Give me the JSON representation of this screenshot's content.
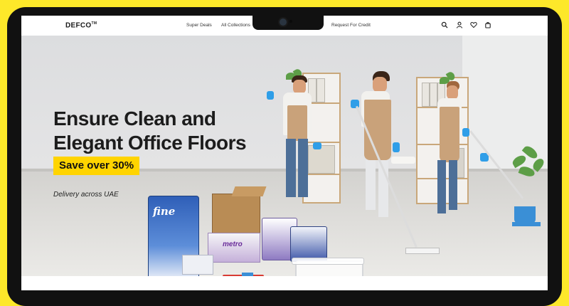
{
  "brand": {
    "logo": "DEFCO",
    "trademark": "TM"
  },
  "nav": {
    "items": [
      "Super Deals",
      "All Collections",
      "Request For Credit"
    ],
    "hidden_item_arrow": "▾",
    "icons": [
      "search-icon",
      "user-icon",
      "heart-icon",
      "cart-icon"
    ]
  },
  "hero": {
    "title": "Ensure Clean and Elegant Office Floors",
    "badge": "Save over 30%",
    "subtitle": "Delivery across UAE"
  },
  "products": {
    "tissue_brand": "fine",
    "detergent_brand": "metro"
  },
  "colors": {
    "frame": "#fde82a",
    "bezel": "#111111",
    "badge": "#ffd400",
    "glove": "#2f9ee8",
    "text": "#1c1c1c"
  }
}
